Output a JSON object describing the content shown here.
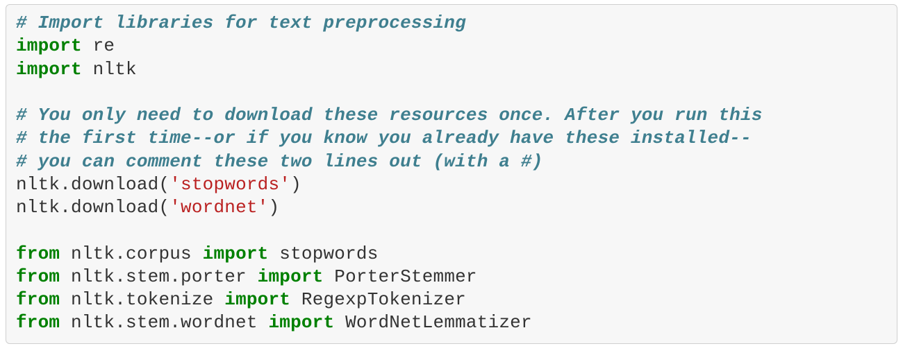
{
  "code": {
    "lines": [
      {
        "tokens": [
          {
            "cls": "c",
            "t": "# Import libraries for text preprocessing"
          }
        ]
      },
      {
        "tokens": [
          {
            "cls": "kw",
            "t": "import"
          },
          {
            "cls": "nm",
            "t": " re"
          }
        ]
      },
      {
        "tokens": [
          {
            "cls": "kw",
            "t": "import"
          },
          {
            "cls": "nm",
            "t": " nltk"
          }
        ]
      },
      {
        "tokens": [
          {
            "cls": "nm",
            "t": " "
          }
        ]
      },
      {
        "tokens": [
          {
            "cls": "c",
            "t": "# You only need to download these resources once. After you run this"
          }
        ]
      },
      {
        "tokens": [
          {
            "cls": "c",
            "t": "# the first time--or if you know you already have these installed--"
          }
        ]
      },
      {
        "tokens": [
          {
            "cls": "c",
            "t": "# you can comment these two lines out (with a #)"
          }
        ]
      },
      {
        "tokens": [
          {
            "cls": "nm",
            "t": "nltk.download("
          },
          {
            "cls": "st",
            "t": "'stopwords'"
          },
          {
            "cls": "nm",
            "t": ")"
          }
        ]
      },
      {
        "tokens": [
          {
            "cls": "nm",
            "t": "nltk.download("
          },
          {
            "cls": "st",
            "t": "'wordnet'"
          },
          {
            "cls": "nm",
            "t": ")"
          }
        ]
      },
      {
        "tokens": [
          {
            "cls": "nm",
            "t": " "
          }
        ]
      },
      {
        "tokens": [
          {
            "cls": "kw",
            "t": "from"
          },
          {
            "cls": "nm",
            "t": " nltk.corpus "
          },
          {
            "cls": "kw",
            "t": "import"
          },
          {
            "cls": "nm",
            "t": " stopwords"
          }
        ]
      },
      {
        "tokens": [
          {
            "cls": "kw",
            "t": "from"
          },
          {
            "cls": "nm",
            "t": " nltk.stem.porter "
          },
          {
            "cls": "kw",
            "t": "import"
          },
          {
            "cls": "nm",
            "t": " PorterStemmer"
          }
        ]
      },
      {
        "tokens": [
          {
            "cls": "kw",
            "t": "from"
          },
          {
            "cls": "nm",
            "t": " nltk.tokenize "
          },
          {
            "cls": "kw",
            "t": "import"
          },
          {
            "cls": "nm",
            "t": " RegexpTokenizer"
          }
        ]
      },
      {
        "tokens": [
          {
            "cls": "kw",
            "t": "from"
          },
          {
            "cls": "nm",
            "t": " nltk.stem.wordnet "
          },
          {
            "cls": "kw",
            "t": "import"
          },
          {
            "cls": "nm",
            "t": " WordNetLemmatizer"
          }
        ]
      }
    ]
  }
}
